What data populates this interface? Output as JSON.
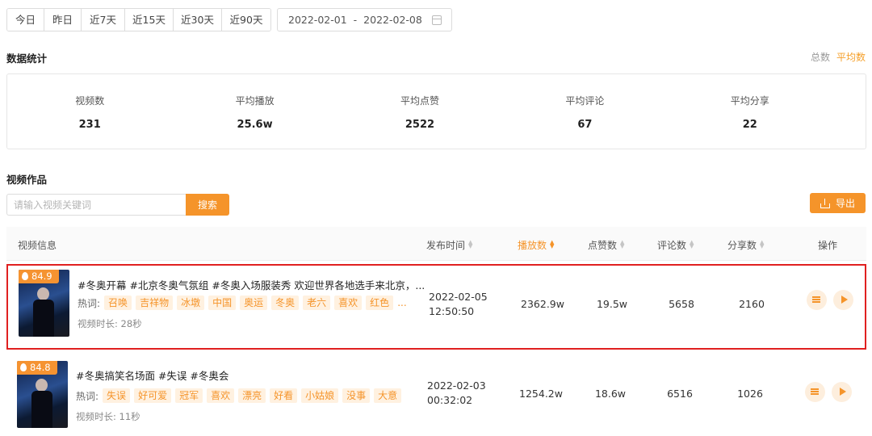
{
  "range_tabs": [
    "今日",
    "昨日",
    "近7天",
    "近15天",
    "近30天",
    "近90天"
  ],
  "date_range": {
    "start": "2022-02-01",
    "separator": "-",
    "end": "2022-02-08"
  },
  "stats_section": {
    "title": "数据统计",
    "modes": [
      "总数",
      "平均数"
    ],
    "active_mode": "平均数",
    "items": [
      {
        "label": "视频数",
        "value": "231"
      },
      {
        "label": "平均播放",
        "value": "25.6w"
      },
      {
        "label": "平均点赞",
        "value": "2522"
      },
      {
        "label": "平均评论",
        "value": "67"
      },
      {
        "label": "平均分享",
        "value": "22"
      }
    ]
  },
  "videos_section": {
    "title": "视频作品",
    "search_placeholder": "请输入视频关键词",
    "search_button": "搜索",
    "export_button": "导出"
  },
  "table": {
    "headers": {
      "info": "视频信息",
      "publish_time": "发布时间",
      "plays": "播放数",
      "likes": "点赞数",
      "comments": "评论数",
      "shares": "分享数",
      "actions": "操作"
    },
    "active_sort": "播放数",
    "hotwords_label": "热词:",
    "duration_label": "视频时长:",
    "rows": [
      {
        "score": "84.9",
        "title": "#冬奥开幕 #北京冬奥气氛组 #冬奥入场服装秀 欢迎世界各地选手来北京，...",
        "tags": [
          "召唤",
          "吉祥物",
          "冰墩",
          "中国",
          "奥运",
          "冬奥",
          "老六",
          "喜欢",
          "红色"
        ],
        "duration": "28秒",
        "publish_date": "2022-02-05",
        "publish_time": "12:50:50",
        "plays": "2362.9w",
        "likes": "19.5w",
        "comments": "5658",
        "shares": "2160",
        "selected": true
      },
      {
        "score": "84.8",
        "title": "#冬奥搞笑名场面 #失误 #冬奥会",
        "tags": [
          "失误",
          "好可爱",
          "冠军",
          "喜欢",
          "漂亮",
          "好看",
          "小姑娘",
          "没事",
          "大意"
        ],
        "duration": "11秒",
        "publish_date": "2022-02-03",
        "publish_time": "00:32:02",
        "plays": "1254.2w",
        "likes": "18.6w",
        "comments": "6516",
        "shares": "1026",
        "selected": false
      }
    ]
  },
  "colors": {
    "accent": "#f5942a",
    "selection": "#e02020",
    "tag_bg": "#fff1e0"
  }
}
